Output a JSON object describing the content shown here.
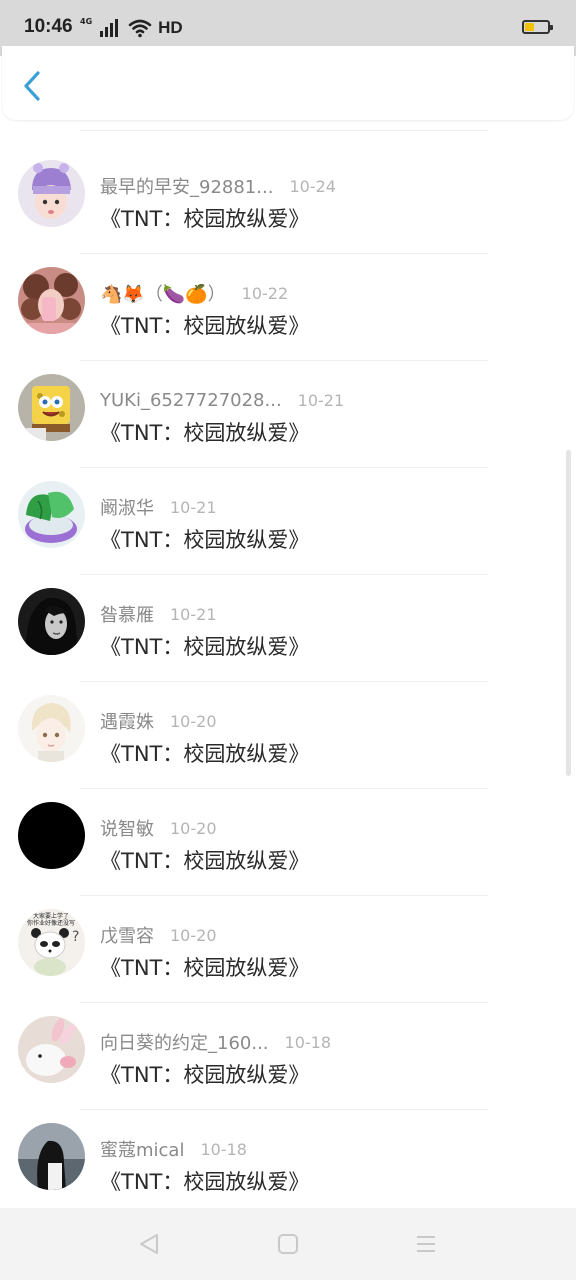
{
  "status_bar": {
    "time": "10:46",
    "network": "4G",
    "hd": "HD",
    "battery_level": 0.4,
    "battery_color": "#f2c200"
  },
  "header": {
    "back_icon": "chevron-left-icon",
    "accent_color": "#3aa0d8"
  },
  "list": {
    "items": [
      {
        "name": "最早的早安_92881...",
        "date": "10-24",
        "title": "《TNT：校园放纵爱》",
        "avatar": "girl-purple-hat"
      },
      {
        "name": "🐴🦊（🍆🍊）",
        "date": "10-22",
        "title": "《TNT：校园放纵爱》",
        "avatar": "girl-curly-hair"
      },
      {
        "name": "YUKi_6527727028...",
        "date": "10-21",
        "title": "《TNT：校园放纵爱》",
        "avatar": "sponge-cartoon"
      },
      {
        "name": "阚淑华",
        "date": "10-21",
        "title": "《TNT：校园放纵爱》",
        "avatar": "green-cabbage"
      },
      {
        "name": "昝慕雁",
        "date": "10-21",
        "title": "《TNT：校园放纵爱》",
        "avatar": "woman-black-white"
      },
      {
        "name": "遇霞姝",
        "date": "10-20",
        "title": "《TNT：校园放纵爱》",
        "avatar": "anime-boy"
      },
      {
        "name": "说智敏",
        "date": "10-20",
        "title": "《TNT：校园放纵爱》",
        "avatar": "black-circle"
      },
      {
        "name": "戊雪容",
        "date": "10-20",
        "title": "《TNT：校园放纵爱》",
        "avatar": "panda-kid-meme"
      },
      {
        "name": "向日葵的约定_160...",
        "date": "10-18",
        "title": "《TNT：校园放纵爱》",
        "avatar": "white-bunny"
      },
      {
        "name": "蜜蔻mical",
        "date": "10-18",
        "title": "《TNT：校园放纵爱》",
        "avatar": "girl-seaside"
      }
    ]
  },
  "meme_avatar_text": [
    "大家要上学了",
    "你作业好像还没写"
  ],
  "nav_bar": {
    "back_icon": "triangle-back-icon",
    "home_icon": "square-home-icon",
    "menu_icon": "menu-lines-icon"
  }
}
